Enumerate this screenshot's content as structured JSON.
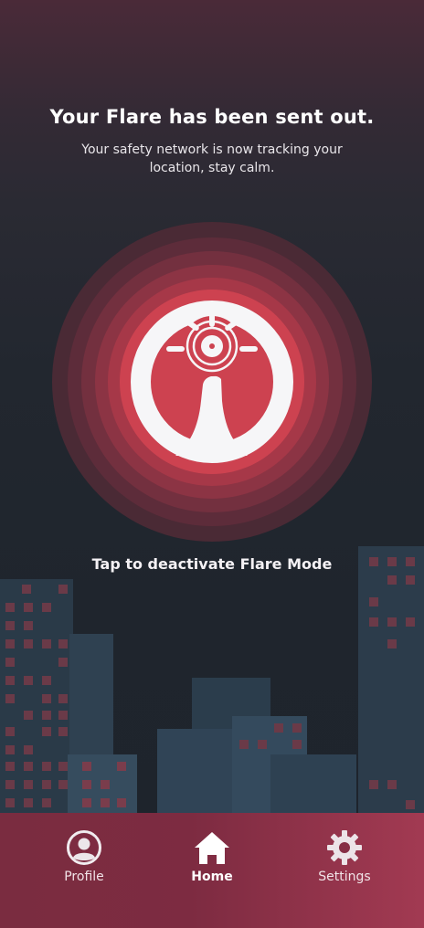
{
  "header": {
    "title": "Your Flare has been sent out.",
    "subtitle": "Your safety network is now tracking your location, stay calm."
  },
  "flare_button": {
    "icon": "flare-hand-icon",
    "action_label": "Tap to deactivate Flare Mode"
  },
  "colors": {
    "accent": "#c83f50",
    "ring_1": "#4a2a35",
    "ring_2": "#5d2c3a",
    "ring_3": "#73303f",
    "ring_4": "#8c3444",
    "ring_5": "#a63848",
    "core": "#cd4250",
    "navbar": "#7d2b41"
  },
  "navbar": {
    "items": [
      {
        "label": "Profile",
        "icon": "profile-icon"
      },
      {
        "label": "Home",
        "icon": "home-icon",
        "active": true
      },
      {
        "label": "Settings",
        "icon": "gear-icon"
      }
    ]
  }
}
